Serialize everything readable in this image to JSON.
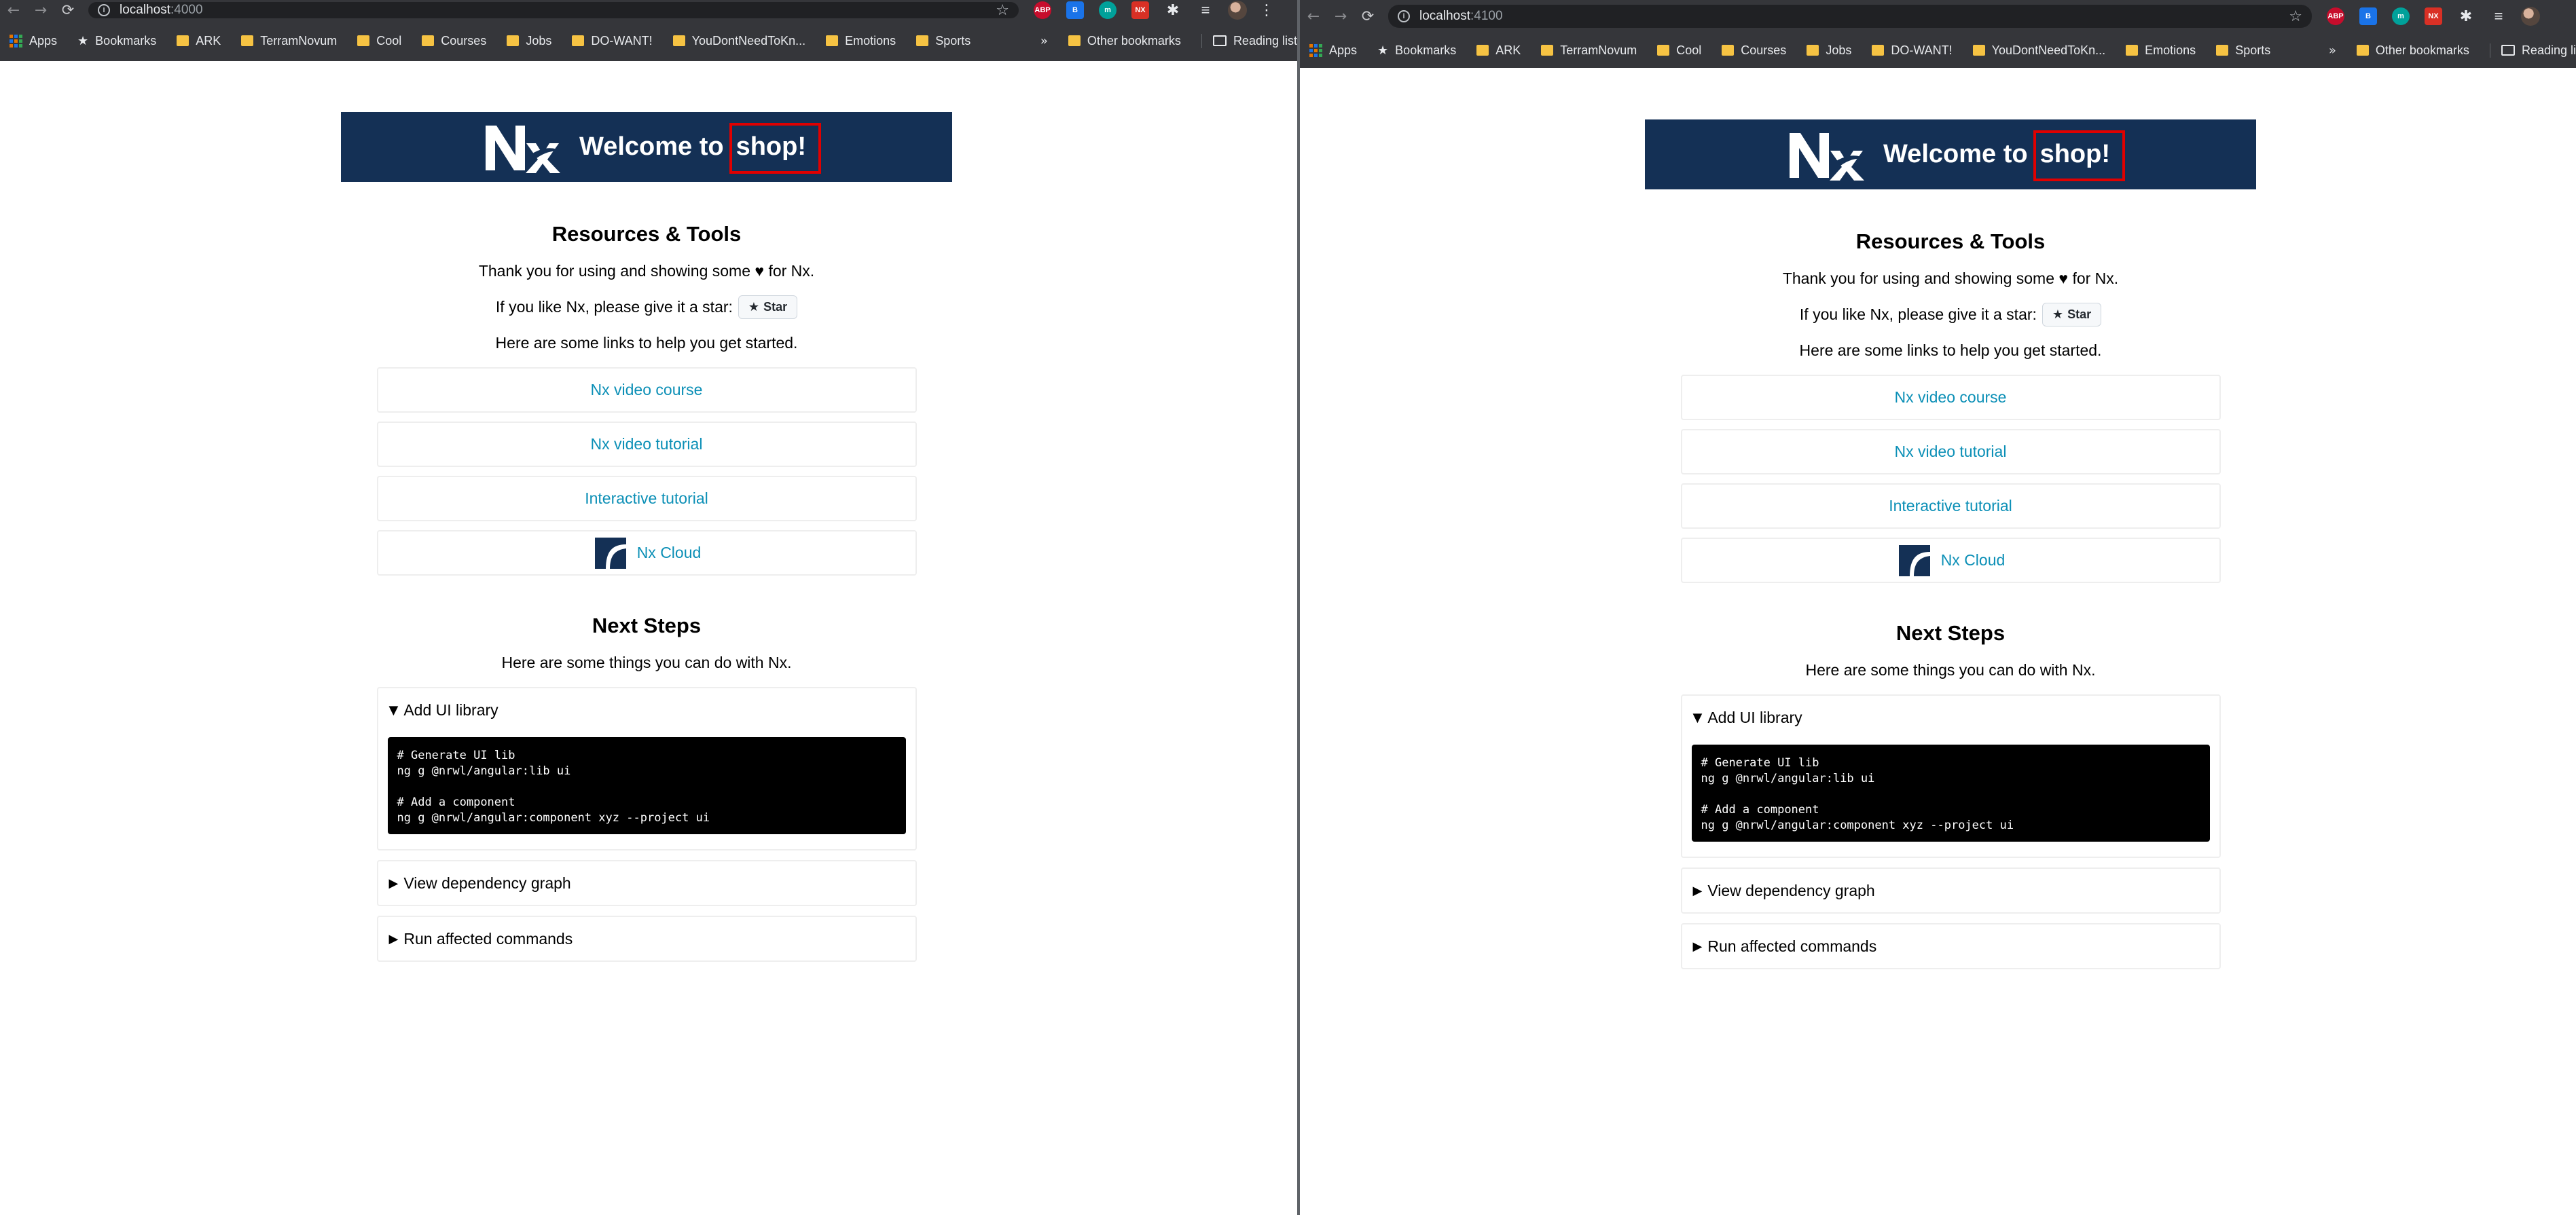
{
  "windows": [
    {
      "address": {
        "host": "localhost",
        "port": ":4000"
      },
      "bookmarks": [
        "Apps",
        "Bookmarks",
        "ARK",
        "TerramNovum",
        "Cool",
        "Courses",
        "Jobs",
        "DO-WANT!",
        "YouDontNeedToKn...",
        "Emotions",
        "Sports"
      ],
      "other_bookmarks": "Other bookmarks",
      "reading_list": "Reading list",
      "chevron": "»"
    },
    {
      "address": {
        "host": "localhost",
        "port": ":4100"
      },
      "bookmarks": [
        "Apps",
        "Bookmarks",
        "ARK",
        "TerramNovum",
        "Cool",
        "Courses",
        "Jobs",
        "DO-WANT!",
        "YouDontNeedToKn...",
        "Emotions",
        "Sports"
      ],
      "other_bookmarks": "Other bookmarks",
      "reading_list": "Reading li",
      "chevron": "»"
    }
  ],
  "extensions": [
    "ABP",
    "B",
    "m",
    "NX"
  ],
  "icons": {
    "back": "back-arrow-icon",
    "forward": "forward-arrow-icon",
    "reload": "reload-icon",
    "info": "info-icon",
    "bookmark_star": "bookmark-star-icon",
    "menu": "kebab-menu-icon"
  },
  "page": {
    "header": {
      "welcome": "Welcome to",
      "app_name": "shop!"
    },
    "resources_title": "Resources & Tools",
    "thanks": "Thank you for using and showing some ♥ for Nx.",
    "star_prompt": "If you like Nx, please give it a star:",
    "star_button": "Star",
    "links_intro": "Here are some links to help you get started.",
    "links": [
      "Nx video course",
      "Nx video tutorial",
      "Interactive tutorial",
      "Nx Cloud"
    ],
    "next_title": "Next Steps",
    "next_intro": "Here are some things you can do with Nx.",
    "steps": [
      {
        "title": "Add UI library",
        "expanded": true,
        "code": "# Generate UI lib\nng g @nrwl/angular:lib ui\n\n# Add a component\nng g @nrwl/angular:component xyz --project ui"
      },
      {
        "title": "View dependency graph",
        "expanded": false
      },
      {
        "title": "Run affected commands",
        "expanded": false
      }
    ]
  },
  "colors": {
    "header_bg": "#143055",
    "link": "#0b8fb6",
    "highlight_box": "#e00000",
    "chrome": "#35363a"
  }
}
